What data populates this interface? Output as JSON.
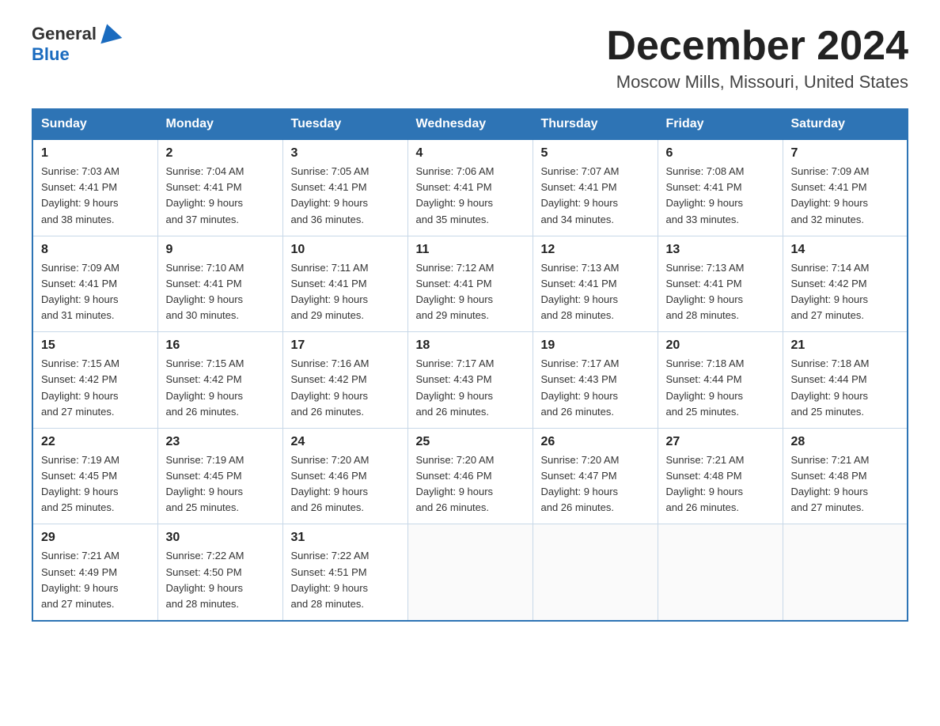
{
  "header": {
    "logo": {
      "general": "General",
      "blue": "Blue"
    },
    "title": "December 2024",
    "location": "Moscow Mills, Missouri, United States"
  },
  "weekdays": [
    "Sunday",
    "Monday",
    "Tuesday",
    "Wednesday",
    "Thursday",
    "Friday",
    "Saturday"
  ],
  "weeks": [
    [
      {
        "day": "1",
        "sunrise": "7:03 AM",
        "sunset": "4:41 PM",
        "daylight": "9 hours and 38 minutes."
      },
      {
        "day": "2",
        "sunrise": "7:04 AM",
        "sunset": "4:41 PM",
        "daylight": "9 hours and 37 minutes."
      },
      {
        "day": "3",
        "sunrise": "7:05 AM",
        "sunset": "4:41 PM",
        "daylight": "9 hours and 36 minutes."
      },
      {
        "day": "4",
        "sunrise": "7:06 AM",
        "sunset": "4:41 PM",
        "daylight": "9 hours and 35 minutes."
      },
      {
        "day": "5",
        "sunrise": "7:07 AM",
        "sunset": "4:41 PM",
        "daylight": "9 hours and 34 minutes."
      },
      {
        "day": "6",
        "sunrise": "7:08 AM",
        "sunset": "4:41 PM",
        "daylight": "9 hours and 33 minutes."
      },
      {
        "day": "7",
        "sunrise": "7:09 AM",
        "sunset": "4:41 PM",
        "daylight": "9 hours and 32 minutes."
      }
    ],
    [
      {
        "day": "8",
        "sunrise": "7:09 AM",
        "sunset": "4:41 PM",
        "daylight": "9 hours and 31 minutes."
      },
      {
        "day": "9",
        "sunrise": "7:10 AM",
        "sunset": "4:41 PM",
        "daylight": "9 hours and 30 minutes."
      },
      {
        "day": "10",
        "sunrise": "7:11 AM",
        "sunset": "4:41 PM",
        "daylight": "9 hours and 29 minutes."
      },
      {
        "day": "11",
        "sunrise": "7:12 AM",
        "sunset": "4:41 PM",
        "daylight": "9 hours and 29 minutes."
      },
      {
        "day": "12",
        "sunrise": "7:13 AM",
        "sunset": "4:41 PM",
        "daylight": "9 hours and 28 minutes."
      },
      {
        "day": "13",
        "sunrise": "7:13 AM",
        "sunset": "4:41 PM",
        "daylight": "9 hours and 28 minutes."
      },
      {
        "day": "14",
        "sunrise": "7:14 AM",
        "sunset": "4:42 PM",
        "daylight": "9 hours and 27 minutes."
      }
    ],
    [
      {
        "day": "15",
        "sunrise": "7:15 AM",
        "sunset": "4:42 PM",
        "daylight": "9 hours and 27 minutes."
      },
      {
        "day": "16",
        "sunrise": "7:15 AM",
        "sunset": "4:42 PM",
        "daylight": "9 hours and 26 minutes."
      },
      {
        "day": "17",
        "sunrise": "7:16 AM",
        "sunset": "4:42 PM",
        "daylight": "9 hours and 26 minutes."
      },
      {
        "day": "18",
        "sunrise": "7:17 AM",
        "sunset": "4:43 PM",
        "daylight": "9 hours and 26 minutes."
      },
      {
        "day": "19",
        "sunrise": "7:17 AM",
        "sunset": "4:43 PM",
        "daylight": "9 hours and 26 minutes."
      },
      {
        "day": "20",
        "sunrise": "7:18 AM",
        "sunset": "4:44 PM",
        "daylight": "9 hours and 25 minutes."
      },
      {
        "day": "21",
        "sunrise": "7:18 AM",
        "sunset": "4:44 PM",
        "daylight": "9 hours and 25 minutes."
      }
    ],
    [
      {
        "day": "22",
        "sunrise": "7:19 AM",
        "sunset": "4:45 PM",
        "daylight": "9 hours and 25 minutes."
      },
      {
        "day": "23",
        "sunrise": "7:19 AM",
        "sunset": "4:45 PM",
        "daylight": "9 hours and 25 minutes."
      },
      {
        "day": "24",
        "sunrise": "7:20 AM",
        "sunset": "4:46 PM",
        "daylight": "9 hours and 26 minutes."
      },
      {
        "day": "25",
        "sunrise": "7:20 AM",
        "sunset": "4:46 PM",
        "daylight": "9 hours and 26 minutes."
      },
      {
        "day": "26",
        "sunrise": "7:20 AM",
        "sunset": "4:47 PM",
        "daylight": "9 hours and 26 minutes."
      },
      {
        "day": "27",
        "sunrise": "7:21 AM",
        "sunset": "4:48 PM",
        "daylight": "9 hours and 26 minutes."
      },
      {
        "day": "28",
        "sunrise": "7:21 AM",
        "sunset": "4:48 PM",
        "daylight": "9 hours and 27 minutes."
      }
    ],
    [
      {
        "day": "29",
        "sunrise": "7:21 AM",
        "sunset": "4:49 PM",
        "daylight": "9 hours and 27 minutes."
      },
      {
        "day": "30",
        "sunrise": "7:22 AM",
        "sunset": "4:50 PM",
        "daylight": "9 hours and 28 minutes."
      },
      {
        "day": "31",
        "sunrise": "7:22 AM",
        "sunset": "4:51 PM",
        "daylight": "9 hours and 28 minutes."
      },
      null,
      null,
      null,
      null
    ]
  ],
  "labels": {
    "sunrise": "Sunrise:",
    "sunset": "Sunset:",
    "daylight": "Daylight:"
  }
}
